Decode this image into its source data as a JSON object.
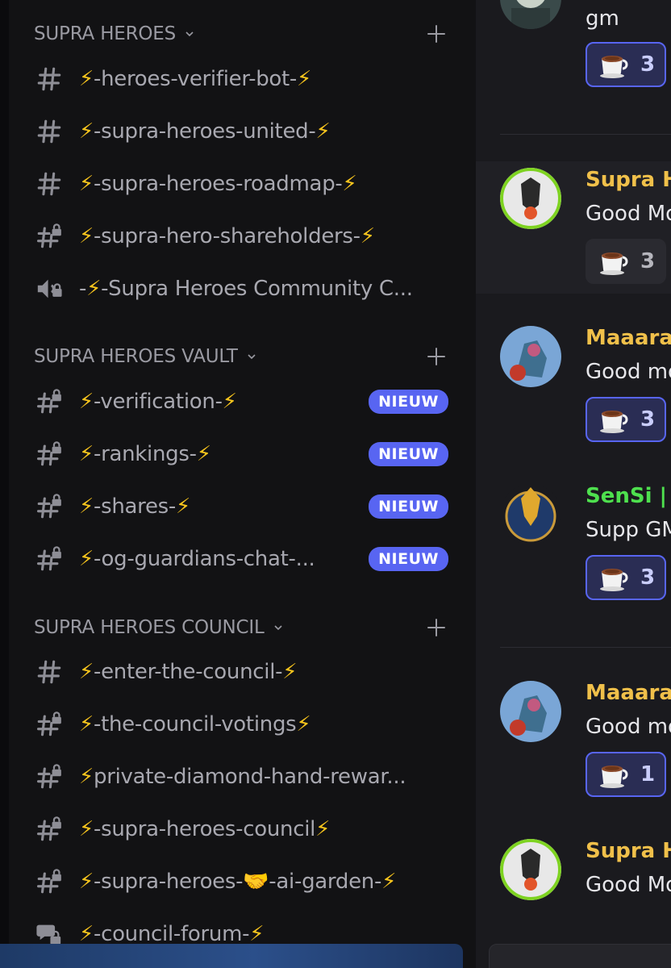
{
  "sidebar": {
    "categories": [
      {
        "label": "SUPRA HEROES",
        "channels": [
          {
            "icon": "hash-icon",
            "name": "⚡-heroes-verifier-bot-⚡"
          },
          {
            "icon": "hash-icon",
            "name": "⚡-supra-heroes-united-⚡"
          },
          {
            "icon": "hash-icon",
            "name": "⚡-supra-heroes-roadmap-⚡"
          },
          {
            "icon": "locked-hash-icon",
            "name": "⚡-supra-hero-shareholders-⚡"
          },
          {
            "icon": "locked-voice-icon",
            "name": "-⚡-Supra Heroes Community C..."
          }
        ]
      },
      {
        "label": "SUPRA HEROES VAULT",
        "channels": [
          {
            "icon": "locked-hash-icon",
            "name": "⚡-verification-⚡",
            "badge": "NIEUW"
          },
          {
            "icon": "locked-hash-icon",
            "name": "⚡-rankings-⚡",
            "badge": "NIEUW"
          },
          {
            "icon": "locked-hash-icon",
            "name": "⚡-shares-⚡",
            "badge": "NIEUW"
          },
          {
            "icon": "locked-hash-icon",
            "name": "⚡-og-guardians-chat-...",
            "badge": "NIEUW"
          }
        ]
      },
      {
        "label": "SUPRA HEROES COUNCIL",
        "channels": [
          {
            "icon": "hash-icon",
            "name": "⚡-enter-the-council-⚡"
          },
          {
            "icon": "locked-hash-icon",
            "name": "⚡-the-council-votings⚡"
          },
          {
            "icon": "locked-hash-icon",
            "name": "⚡private-diamond-hand-rewar..."
          },
          {
            "icon": "locked-hash-icon",
            "name": "⚡-supra-heroes-council⚡"
          },
          {
            "icon": "locked-hash-icon",
            "name": "⚡-supra-heroes-🤝-ai-garden-⚡"
          },
          {
            "icon": "locked-forum-icon",
            "name": "⚡-council-forum-⚡"
          }
        ]
      }
    ]
  },
  "chat": {
    "messages": [
      {
        "author": "",
        "author_color": "#f0c04a",
        "text": "gm",
        "reaction": {
          "emoji": "coffee-icon",
          "count": "3",
          "active": true
        }
      },
      {
        "author": "Supra H",
        "author_color": "#f0c04a",
        "text": "Good Mo",
        "reaction": {
          "emoji": "coffee-icon",
          "count": "3",
          "active": false
        }
      },
      {
        "author": "Maaaraa",
        "author_color": "#f0c04a",
        "text": "Good mo",
        "reaction": {
          "emoji": "coffee-icon",
          "count": "3",
          "active": true
        }
      },
      {
        "author": "SenSi | S",
        "author_color": "#4ee04e",
        "text": "Supp GM",
        "reaction": {
          "emoji": "coffee-icon",
          "count": "3",
          "active": true
        }
      },
      {
        "author": "Maaaraa",
        "author_color": "#f0c04a",
        "text": "Good mo",
        "reaction": {
          "emoji": "coffee-icon",
          "count": "1",
          "active": true
        }
      },
      {
        "author": "Supra H",
        "author_color": "#f0c04a",
        "text": "Good Mo"
      }
    ]
  },
  "colors": {
    "accent": "#5865f2",
    "bolt": "#f8c51d",
    "muted_text": "#a8a8b0"
  }
}
